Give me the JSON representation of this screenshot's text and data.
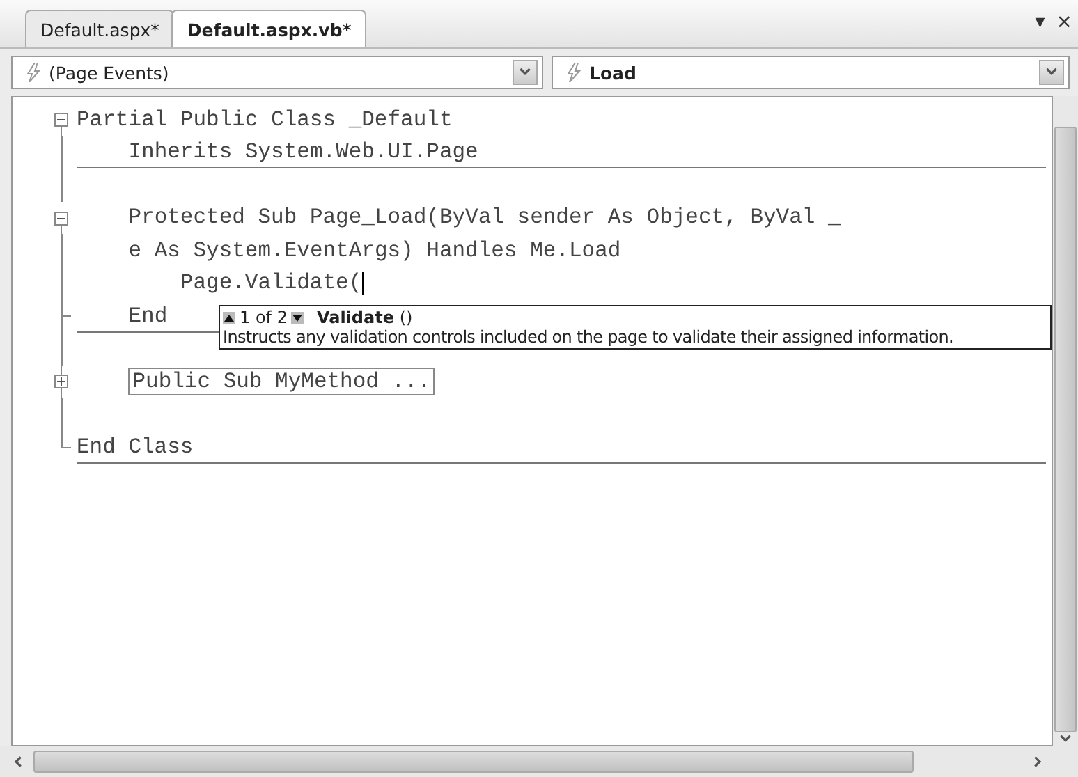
{
  "tabs": [
    {
      "label": "Default.aspx*",
      "selected": false
    },
    {
      "label": "Default.aspx.vb*",
      "selected": true
    }
  ],
  "window_controls": [
    "▾",
    "×"
  ],
  "dropdowns": [
    {
      "label": "(Page Events)",
      "implemented": false
    },
    {
      "label": "Load",
      "implemented": true
    }
  ],
  "code_blocks": [
    {
      "lines": [
        {
          "kind": "open",
          "text": "Partial Public Class _Default",
          "caret": false
        },
        {
          "kind": "line",
          "text": "    Inherits System.Web.UI.Page",
          "caret": false
        }
      ]
    },
    {
      "lines": [
        {
          "kind": "line",
          "caret": false
        },
        {
          "kind": "open",
          "text": "    Protected Sub Page_Load(ByVal sender As Object, ByVal _",
          "caret": false
        },
        {
          "kind": "line",
          "text": "    e As System.EventArgs) Handles Me.Load",
          "caret": false
        },
        {
          "kind": "line",
          "text": "        Page.Validate(",
          "caret": true
        },
        {
          "kind": "tick",
          "text": "    End",
          "caret": false
        }
      ]
    },
    {
      "lines": [
        {
          "kind": "line",
          "caret": false
        },
        {
          "kind": "closed",
          "text": "    Public Sub MyMethod ...",
          "caret": false
        },
        {
          "kind": "line",
          "caret": false
        },
        {
          "kind": "end",
          "text": "End Class",
          "caret": false
        }
      ]
    }
  ],
  "tooltip": {
    "counter": "1 of 2",
    "signature": "**Validate** ()",
    "description": "Instructs any validation controls included on the page to validate their assigned information."
  }
}
